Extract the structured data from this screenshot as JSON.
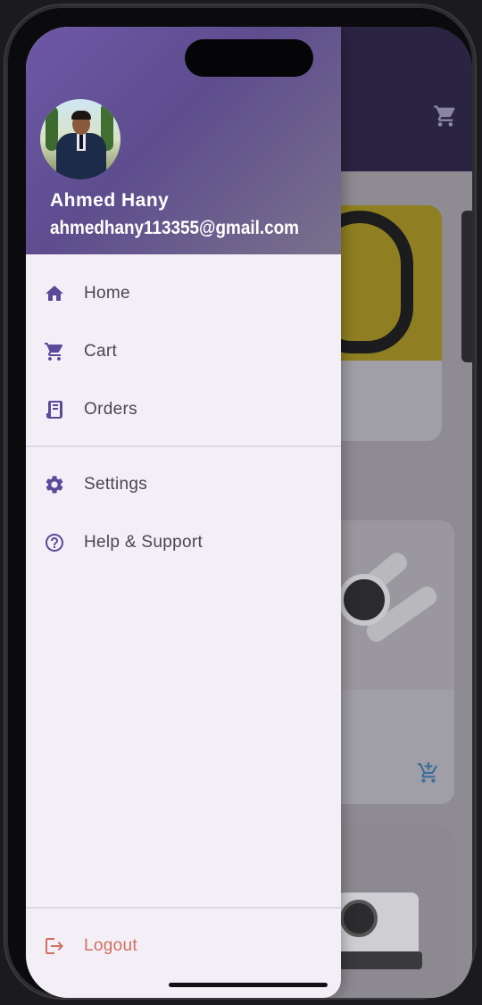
{
  "user": {
    "name": "Ahmed Hany",
    "email": "ahmedhany113355@gmail.com"
  },
  "menu": {
    "items": [
      {
        "label": "Home",
        "icon": "home-icon"
      },
      {
        "label": "Cart",
        "icon": "cart-icon"
      },
      {
        "label": "Orders",
        "icon": "orders-icon"
      },
      {
        "label": "Settings",
        "icon": "gear-icon"
      },
      {
        "label": "Help & Support",
        "icon": "help-icon"
      }
    ],
    "logout": {
      "label": "Logout",
      "icon": "logout-icon"
    }
  },
  "colors": {
    "accent": "#5b4a9a",
    "header_start": "#6e58a8",
    "drawer_bg": "#f4eff7",
    "logout": "#d0705f"
  }
}
